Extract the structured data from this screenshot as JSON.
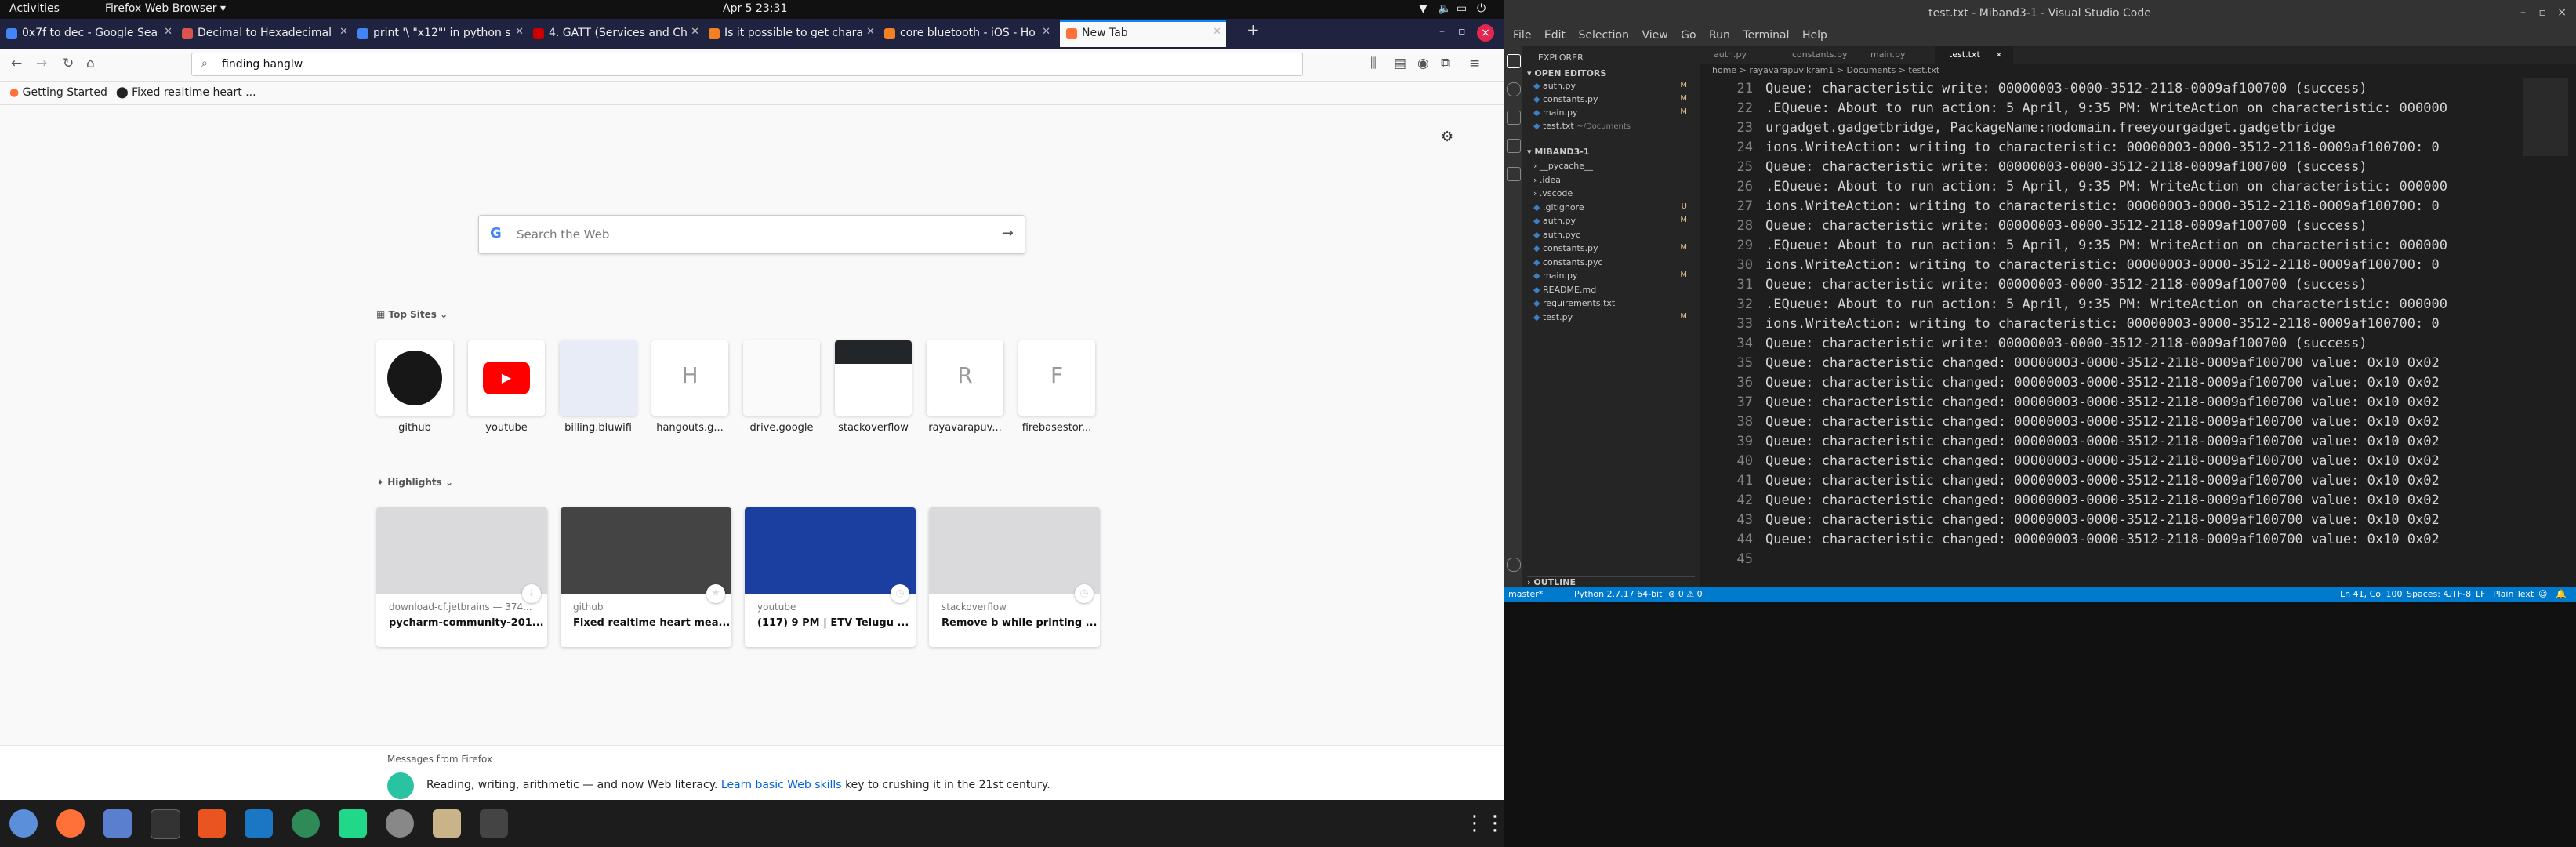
{
  "topbar": {
    "activities": "Activities",
    "app_menu": "Firefox Web Browser ▾",
    "clock": "Apr 5  23:31"
  },
  "firefox": {
    "tabs": [
      {
        "label": "0x7f to dec - Google Sea",
        "color": "#4285f4"
      },
      {
        "label": "Decimal to Hexadecimal",
        "color": "#d9534f"
      },
      {
        "label": "print '\\ \"x12\"' in python s",
        "color": "#4285f4"
      },
      {
        "label": "4. GATT (Services and Ch",
        "color": "#c00"
      },
      {
        "label": "Is it possible to get chara",
        "color": "#f48024"
      },
      {
        "label": "core bluetooth - iOS - Ho",
        "color": "#f48024"
      },
      {
        "label": "New Tab",
        "color": "#ff7139"
      }
    ],
    "new_tab_symbol": "+",
    "url_value": "finding hanglw",
    "bookmarks": [
      "Getting Started",
      "Fixed realtime heart ..."
    ],
    "search_placeholder": "Search the Web",
    "top_sites_label": "Top Sites",
    "top_sites": [
      {
        "label": "github",
        "letter": ""
      },
      {
        "label": "youtube",
        "letter": ""
      },
      {
        "label": "billing.bluwifi",
        "letter": ""
      },
      {
        "label": "hangouts.g...",
        "letter": "H"
      },
      {
        "label": "drive.google",
        "letter": ""
      },
      {
        "label": "stackoverflow",
        "letter": ""
      },
      {
        "label": "rayavarapuv...",
        "letter": "R"
      },
      {
        "label": "firebasestor...",
        "letter": "F"
      }
    ],
    "highlights_label": "Highlights",
    "highlights": [
      {
        "source": "download-cf.jetbrains — 374...",
        "title": "pycharm-community-201...",
        "badge": "↓"
      },
      {
        "source": "github",
        "title": "Fixed realtime heart mea...",
        "badge": "★"
      },
      {
        "source": "youtube",
        "title": "(117) 9 PM | ETV Telugu ...",
        "badge": "◷"
      },
      {
        "source": "stackoverflow",
        "title": "Remove b while printing ...",
        "badge": "◷"
      }
    ],
    "messages_label": "Messages from Firefox",
    "message_text": "Reading, writing, arithmetic — and now Web literacy.",
    "message_link": "Learn basic Web skills",
    "message_rest": "key to crushing it in the 21st century."
  },
  "vscode": {
    "title": "test.txt - Miband3-1 - Visual Studio Code",
    "menu": [
      "File",
      "Edit",
      "Selection",
      "View",
      "Go",
      "Run",
      "Terminal",
      "Help"
    ],
    "explorer_label": "EXPLORER",
    "open_editors_label": "OPEN EDITORS",
    "open_editors": [
      {
        "name": "auth.py",
        "mark": "M"
      },
      {
        "name": "constants.py",
        "mark": "M"
      },
      {
        "name": "main.py",
        "mark": "M"
      },
      {
        "name": "test.txt",
        "path": "~/Documents",
        "mark": ""
      }
    ],
    "project_label": "MIBAND3-1",
    "files": [
      {
        "name": "__pycache__",
        "mark": ""
      },
      {
        "name": ".idea",
        "mark": ""
      },
      {
        "name": ".vscode",
        "mark": ""
      },
      {
        "name": ".gitignore",
        "mark": "U"
      },
      {
        "name": "auth.py",
        "mark": "M"
      },
      {
        "name": "auth.pyc",
        "mark": ""
      },
      {
        "name": "constants.py",
        "mark": "M"
      },
      {
        "name": "constants.pyc",
        "mark": ""
      },
      {
        "name": "main.py",
        "mark": "M"
      },
      {
        "name": "README.md",
        "mark": ""
      },
      {
        "name": "requirements.txt",
        "mark": ""
      },
      {
        "name": "test.py",
        "mark": "M"
      }
    ],
    "outline_label": "OUTLINE",
    "editor_tabs": [
      "auth.py",
      "constants.py",
      "main.py",
      "test.txt"
    ],
    "breadcrumb": "home > rayavarapuvikram1 > Documents > test.txt",
    "lines": [
      {
        "n": "21",
        "t": "Queue: characteristic write: 00000003-0000-3512-2118-0009af100700 (success)"
      },
      {
        "n": "22",
        "t": ".EQueue: About to run action: 5 April, 9:35 PM: WriteAction on characteristic: 000000"
      },
      {
        "n": "23",
        "t": "urgadget.gadgetbridge, PackageName:nodomain.freeyourgadget.gadgetbridge"
      },
      {
        "n": "24",
        "t": "ions.WriteAction: writing to characteristic: 00000003-0000-3512-2118-0009af100700: 0"
      },
      {
        "n": "25",
        "t": "Queue: characteristic write: 00000003-0000-3512-2118-0009af100700 (success)"
      },
      {
        "n": "26",
        "t": ".EQueue: About to run action: 5 April, 9:35 PM: WriteAction on characteristic: 000000"
      },
      {
        "n": "27",
        "t": "ions.WriteAction: writing to characteristic: 00000003-0000-3512-2118-0009af100700: 0"
      },
      {
        "n": "28",
        "t": "Queue: characteristic write: 00000003-0000-3512-2118-0009af100700 (success)"
      },
      {
        "n": "29",
        "t": ".EQueue: About to run action: 5 April, 9:35 PM: WriteAction on characteristic: 000000"
      },
      {
        "n": "30",
        "t": "ions.WriteAction: writing to characteristic: 00000003-0000-3512-2118-0009af100700: 0"
      },
      {
        "n": "31",
        "t": "Queue: characteristic write: 00000003-0000-3512-2118-0009af100700 (success)"
      },
      {
        "n": "32",
        "t": ".EQueue: About to run action: 5 April, 9:35 PM: WriteAction on characteristic: 000000"
      },
      {
        "n": "33",
        "t": "ions.WriteAction: writing to characteristic: 00000003-0000-3512-2118-0009af100700: 0"
      },
      {
        "n": "34",
        "t": "Queue: characteristic write: 00000003-0000-3512-2118-0009af100700 (success)"
      },
      {
        "n": "35",
        "t": "Queue: characteristic changed: 00000003-0000-3512-2118-0009af100700 value: 0x10 0x02"
      },
      {
        "n": "36",
        "t": "Queue: characteristic changed: 00000003-0000-3512-2118-0009af100700 value: 0x10 0x02"
      },
      {
        "n": "37",
        "t": "Queue: characteristic changed: 00000003-0000-3512-2118-0009af100700 value: 0x10 0x02"
      },
      {
        "n": "38",
        "t": "Queue: characteristic changed: 00000003-0000-3512-2118-0009af100700 value: 0x10 0x02"
      },
      {
        "n": "39",
        "t": "Queue: characteristic changed: 00000003-0000-3512-2118-0009af100700 value: 0x10 0x02"
      },
      {
        "n": "40",
        "t": "Queue: characteristic changed: 00000003-0000-3512-2118-0009af100700 value: 0x10 0x02"
      },
      {
        "n": "41",
        "t": "Queue: characteristic changed: 00000003-0000-3512-2118-0009af100700 value: 0x10 0x02"
      },
      {
        "n": "42",
        "t": "Queue: characteristic changed: 00000003-0000-3512-2118-0009af100700 value: 0x10 0x02"
      },
      {
        "n": "43",
        "t": "Queue: characteristic changed: 00000003-0000-3512-2118-0009af100700 value: 0x10 0x02"
      },
      {
        "n": "44",
        "t": "Queue: characteristic changed: 00000003-0000-3512-2118-0009af100700 value: 0x10 0x02"
      },
      {
        "n": "45",
        "t": ""
      }
    ],
    "status": {
      "branch": "master*",
      "python": "Python 2.7.17 64-bit",
      "problems": "⊗ 0 ⚠ 0",
      "cursor": "Ln 41, Col 100",
      "spaces": "Spaces: 4",
      "encoding": "UTF-8",
      "eol": "LF",
      "language": "Plain Text"
    }
  },
  "colors": {
    "firefox_accent": "#0a84ff",
    "vscode_status": "#007acc",
    "link": "#0060df"
  }
}
